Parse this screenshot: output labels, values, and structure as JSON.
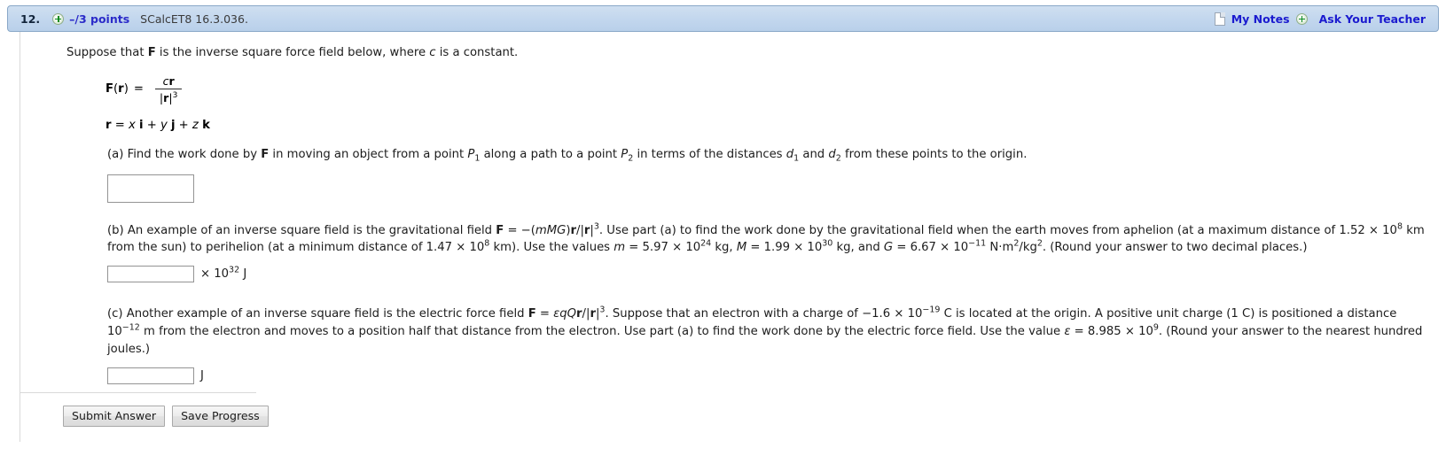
{
  "header": {
    "question_number": "12.",
    "plus_icon": "plus-circle-icon",
    "points": "–/3 points",
    "code": "SCalcET8 16.3.036.",
    "notes_icon": "note-page-icon",
    "notes_label": "My Notes",
    "teacher_plus_icon": "plus-circle-icon",
    "teacher_label": "Ask Your Teacher",
    "link_color": "#1b1bcf",
    "bar_color": "#c3d7ee"
  },
  "question": {
    "intro_pre": "Suppose that ",
    "intro_F": "F",
    "intro_mid": " is the inverse square force field below, where ",
    "intro_c": "c",
    "intro_post": " is a constant.",
    "formula_lhs_F": "F",
    "formula_lhs_paren_open": "(",
    "formula_lhs_r": "r",
    "formula_lhs_paren_close": ")",
    "formula_eq": "=",
    "formula_num_c": "c",
    "formula_num_r": "r",
    "formula_den_bar1": "|",
    "formula_den_r": "r",
    "formula_den_bar2": "|",
    "formula_den_exp": "3",
    "rdef_r": "r",
    "rdef_eq": " = ",
    "rdef_x": "x",
    "rdef_i": "i",
    "rdef_plus1": " + ",
    "rdef_y": "y",
    "rdef_j": "j",
    "rdef_plus2": " + ",
    "rdef_z": "z",
    "rdef_k": "k"
  },
  "parts": {
    "a": {
      "label": "(a) ",
      "t1": "Find the work done by ",
      "F": "F",
      "t2": " in moving an object from a point ",
      "P": "P",
      "sub1": "1",
      "t3": " along a path to a point ",
      "P2": "P",
      "sub2": "2",
      "t4": " in terms of the distances ",
      "d1": "d",
      "d1sub": "1",
      "t5": " and ",
      "d2": "d",
      "d2sub": "2",
      "t6": " from these points to the origin.",
      "answer_value": ""
    },
    "b": {
      "label": "(b) ",
      "t1": "An example of an inverse square field is the gravitational field  ",
      "F": "F",
      "eq": " = −(",
      "mMG": "mMG",
      "close": ")",
      "r": "r",
      "slash": "/|",
      "r2": "r",
      "bar": "|",
      "exp3": "3",
      "t2": ".  Use part (a) to find the work done by the gravitational field when the earth moves from aphelion (at a maximum distance of ",
      "val1": "1.52 × 10",
      "val1exp": "8",
      "t3": " km from the sun) to perihelion (at a minimum distance of ",
      "val2": "1.47 × 10",
      "val2exp": "8",
      "t4": " km). Use the values ",
      "m": "m",
      "meq": " = 5.97 × 10",
      "mexp": "24",
      "munit": " kg, ",
      "M": "M",
      "Meq": " = 1.99 × 10",
      "Mexp": "30",
      "Munit": " kg, and ",
      "G": "G",
      "Geq": " = 6.67 × 10",
      "Gexp": "−11",
      "Gunit": " N·m",
      "Gunitexp": "2",
      "Gunit2": "/kg",
      "Gunit2exp": "2",
      "t5": ". (Round your answer to two decimal places.)",
      "answer_value": "",
      "unit_pre": "× 10",
      "unit_exp": "32",
      "unit_post": " J"
    },
    "c": {
      "label": "(c) ",
      "t1": "Another example of an inverse square field is the electric force field  ",
      "F": "F",
      "eq": " = ",
      "eps": "εqQ",
      "r": "r",
      "slash": "/|",
      "r2": "r",
      "bar": "|",
      "exp3": "3",
      "t2": ".  Suppose that an electron with a charge of  −1.6 × 10",
      "chargeexp": "−19",
      "t3": "  C is located at the origin. A positive unit charge (1 C) is positioned a distance 10",
      "distexp": "−12",
      "t4": " m from the electron and moves to a position half that distance from the electron. Use part (a) to find the work done by the electric force field. Use the value ",
      "epsilon": "ε",
      "epseq": " = 8.985 × 10",
      "epsexp": "9",
      "t5": ". (Round your answer to the nearest hundred joules.)",
      "answer_value": "",
      "unit": "J"
    }
  },
  "footer": {
    "submit_label": "Submit Answer",
    "save_label": "Save Progress"
  }
}
